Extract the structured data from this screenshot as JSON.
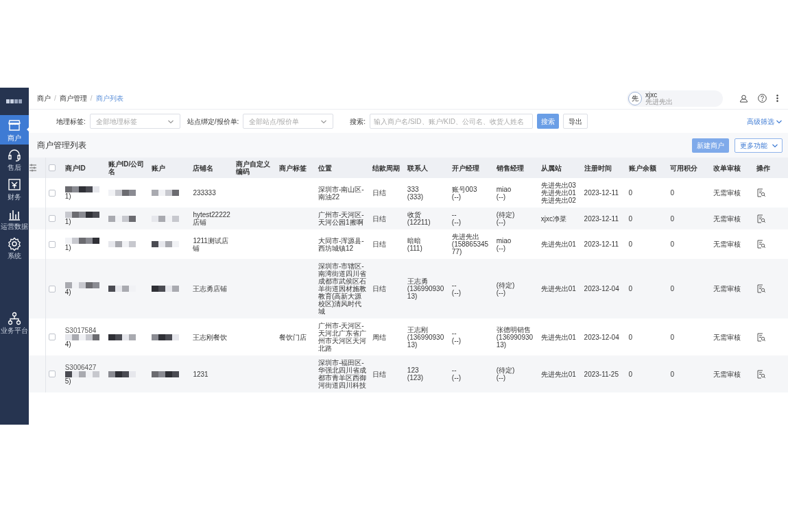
{
  "sidebar": {
    "items": [
      {
        "label": "商户",
        "selected": true
      },
      {
        "label": "售后",
        "selected": false
      },
      {
        "label": "财务",
        "selected": false
      },
      {
        "label": "运营数据",
        "selected": false
      },
      {
        "label": "系统",
        "selected": false
      },
      {
        "label": "业务平台",
        "selected": false
      }
    ]
  },
  "breadcrumb": {
    "separator": "/",
    "items": [
      "商户",
      "商户管理",
      "商户列表"
    ]
  },
  "user": {
    "avatar": "先",
    "name": "xjxc",
    "subtitle": "先进先出"
  },
  "filters": [
    {
      "label": "地理标签:",
      "placeholder": "全部地理标签"
    },
    {
      "label": "站点绑定/报价单:",
      "placeholder": "全部站点/报价单"
    }
  ],
  "search": {
    "label": "搜索:",
    "placeholder": "输入商户名/SID、账户/KID、公司名、收货人姓名",
    "button": "搜索",
    "export": "导出"
  },
  "advanced_filter": "高级筛选",
  "list_title": "商户管理列表",
  "actions": {
    "create": "新建商户",
    "more": "更多功能"
  },
  "table": {
    "columns": [
      "商户ID",
      "账户ID/公司名",
      "账户",
      "店铺名",
      "商户自定义编码",
      "商户标签",
      "位置",
      "结款周期",
      "联系人",
      "开户经理",
      "销售经理",
      "从属站",
      "注册时间",
      "账户余额",
      "可用积分",
      "改单审核",
      "操作"
    ],
    "header_checked": false,
    "rows": [
      {
        "checked": false,
        "id_tail": "1)",
        "redacted": true,
        "store": "233333",
        "location": "深圳市-南山区-南油22",
        "settlement": "日结",
        "contact": [
          "333",
          "(333)"
        ],
        "opening_manager": [
          "账号003",
          "(--)"
        ],
        "sales_manager": [
          "miao",
          "(--)"
        ],
        "stations": [
          "先进先出03",
          "先进先出01",
          "先进先出02"
        ],
        "registered": "2023-12-11",
        "balance": "0",
        "points": "0",
        "audit": "无需审核"
      },
      {
        "checked": false,
        "id_tail": "1)",
        "redacted": true,
        "store": "hytest22222店铺",
        "location": "广州市-天河区-天河公园1擦啊",
        "settlement": "日结",
        "contact": [
          "收货",
          "(12211)"
        ],
        "opening_manager": [
          "--",
          "(--)"
        ],
        "sales_manager": [
          "(待定)",
          "(--)"
        ],
        "stations": [
          "xjxc净菜"
        ],
        "registered": "2023-12-11",
        "balance": "0",
        "points": "0",
        "audit": "无需审核"
      },
      {
        "checked": false,
        "id_tail": "1)",
        "redacted": true,
        "store": "1211测试店铺",
        "location": "大同市-浑源县-西坊城镇12",
        "settlement": "日结",
        "contact": [
          "暗暗",
          "(111)"
        ],
        "opening_manager": [
          "先进先出",
          "(15886534577)"
        ],
        "sales_manager": [
          "miao",
          "(--)"
        ],
        "stations": [
          "先进先出01"
        ],
        "registered": "2023-12-11",
        "balance": "0",
        "points": "0",
        "audit": "无需审核"
      },
      {
        "checked": false,
        "id_tail": "4)",
        "redacted": true,
        "store": "王志勇店铺",
        "location": "深圳市-市辖区-南湾街道四川省成都市武侯区石羊街道因材施教教育(高新大源校区)清风时代城",
        "settlement": "日结",
        "contact": [
          "王志勇",
          "(13699093013)"
        ],
        "opening_manager": [
          "--",
          "(--)"
        ],
        "sales_manager": [
          "(待定)",
          "(--)"
        ],
        "stations": [
          "先进先出01"
        ],
        "registered": "2023-12-04",
        "balance": "0",
        "points": "0",
        "audit": "无需审核"
      },
      {
        "checked": false,
        "id_head": "S3017584",
        "id_tail": "4)",
        "redacted": true,
        "store": "王志刚餐饮",
        "tag": "餐饮门店",
        "location": "广州市-天河区-天河北广东省广州市天河区天河北路",
        "settlement": "周结",
        "contact": [
          "王志刚",
          "(13699093013)"
        ],
        "opening_manager": [
          "--",
          "(--)"
        ],
        "sales_manager": [
          "张德明销售",
          "(13699093013)"
        ],
        "stations": [
          "先进先出01"
        ],
        "registered": "2023-12-04",
        "balance": "0",
        "points": "0",
        "audit": "无需审核"
      },
      {
        "checked": false,
        "id_head": "S3006427",
        "id_tail": "5)",
        "redacted": true,
        "store": "1231",
        "location": "深圳市-福田区-华强北四川省成都市青羊区西御河街道四川科技",
        "settlement": "日结",
        "contact": [
          "123",
          "(123)"
        ],
        "opening_manager": [
          "--",
          "(--)"
        ],
        "sales_manager": [
          "(待定)",
          "(--)"
        ],
        "stations": [
          "先进先出01"
        ],
        "registered": "2023-11-25",
        "balance": "0",
        "points": "0",
        "audit": "无需审核"
      }
    ]
  }
}
